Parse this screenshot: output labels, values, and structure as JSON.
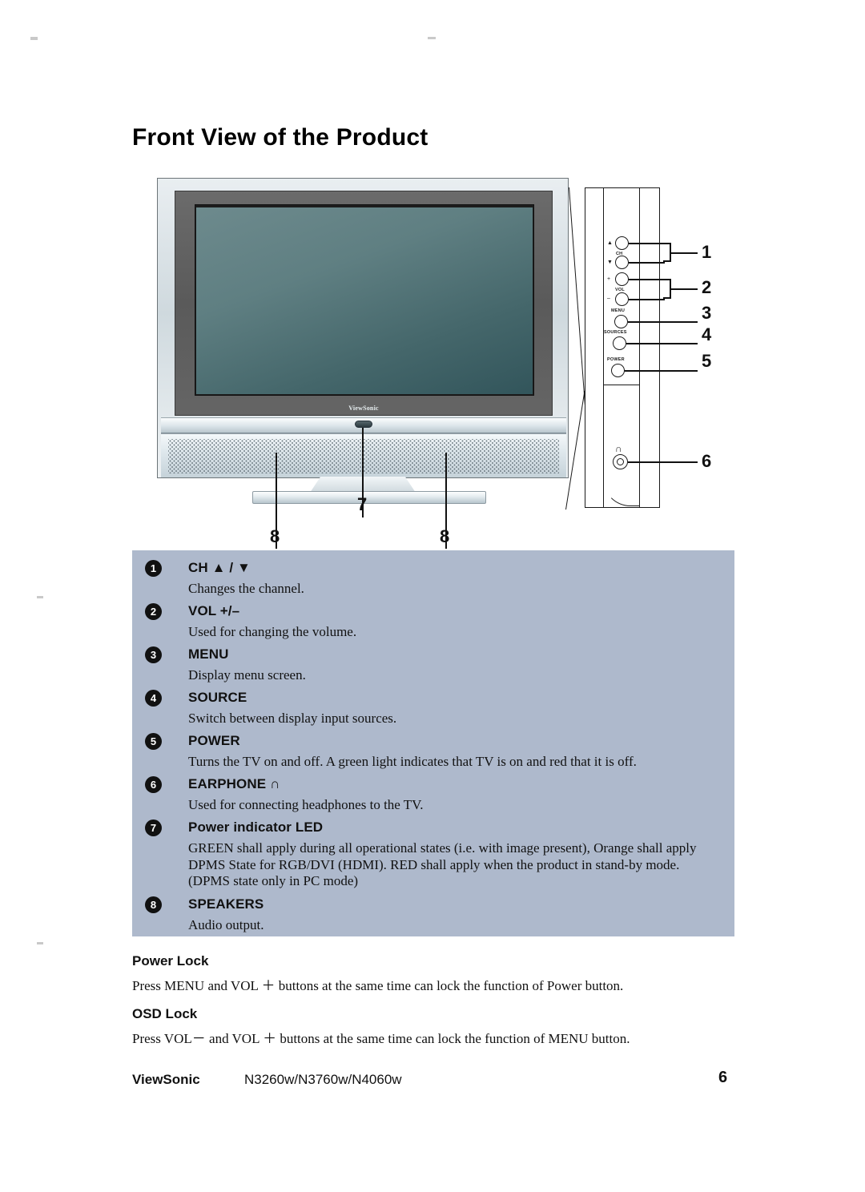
{
  "document": {
    "title": "Front View of the Product"
  },
  "figure": {
    "tv_logo": "ViewSonic",
    "control_panel": {
      "ch_label": "CH",
      "ch_up_symbol": "▲",
      "ch_down_symbol": "▼",
      "vol_label": "VOL",
      "vol_plus_symbol": "+",
      "vol_minus_symbol": "–",
      "menu_label": "MENU",
      "sources_label": "SOURCES",
      "power_label": "POWER",
      "earphone_icon": "∩"
    },
    "callouts": {
      "c1": "1",
      "c2": "2",
      "c3": "3",
      "c4": "4",
      "c5": "5",
      "c6": "6",
      "c7": "7",
      "c8_left": "8",
      "c8_right": "8"
    }
  },
  "specs": {
    "items": [
      {
        "number": "1",
        "heading": "CH ▲ /  ▼",
        "body": "Changes the channel."
      },
      {
        "number": "2",
        "heading": "VOL +/–",
        "body": "Used for changing the volume."
      },
      {
        "number": "3",
        "heading": "MENU",
        "body": "Display menu screen."
      },
      {
        "number": "4",
        "heading": "SOURCE",
        "body": "Switch between display input sources."
      },
      {
        "number": "5",
        "heading": "POWER",
        "body": "Turns the TV on and off. A green light indicates that TV is on and red that it is off."
      },
      {
        "number": "6",
        "heading": "EARPHONE ∩",
        "body": "Used for connecting headphones to the TV."
      },
      {
        "number": "7",
        "heading": "Power indicator LED",
        "body": "GREEN shall apply during all operational states (i.e. with image present), Orange shall apply DPMS State for RGB/DVI (HDMI). RED shall apply when the product in stand-by mode.(DPMS state only in PC mode)"
      },
      {
        "number": "8",
        "heading": "SPEAKERS",
        "body": "Audio output."
      }
    ]
  },
  "locks": {
    "power_lock": {
      "heading": "Power Lock",
      "body": "Press MENU and VOL ＋ buttons at the same time can lock the function of Power button."
    },
    "osd_lock": {
      "heading": "OSD Lock",
      "body": "Press VOL－ and VOL ＋ buttons at the same time can lock the function of MENU button."
    }
  },
  "footer": {
    "brand": "ViewSonic",
    "models": "N3260w/N3760w/N4060w",
    "page_number": "6"
  },
  "colors": {
    "panel_background": "#aeb9cc",
    "screen": "#5f7f82",
    "bezel": "#5e5e5e",
    "ink": "#111111"
  }
}
